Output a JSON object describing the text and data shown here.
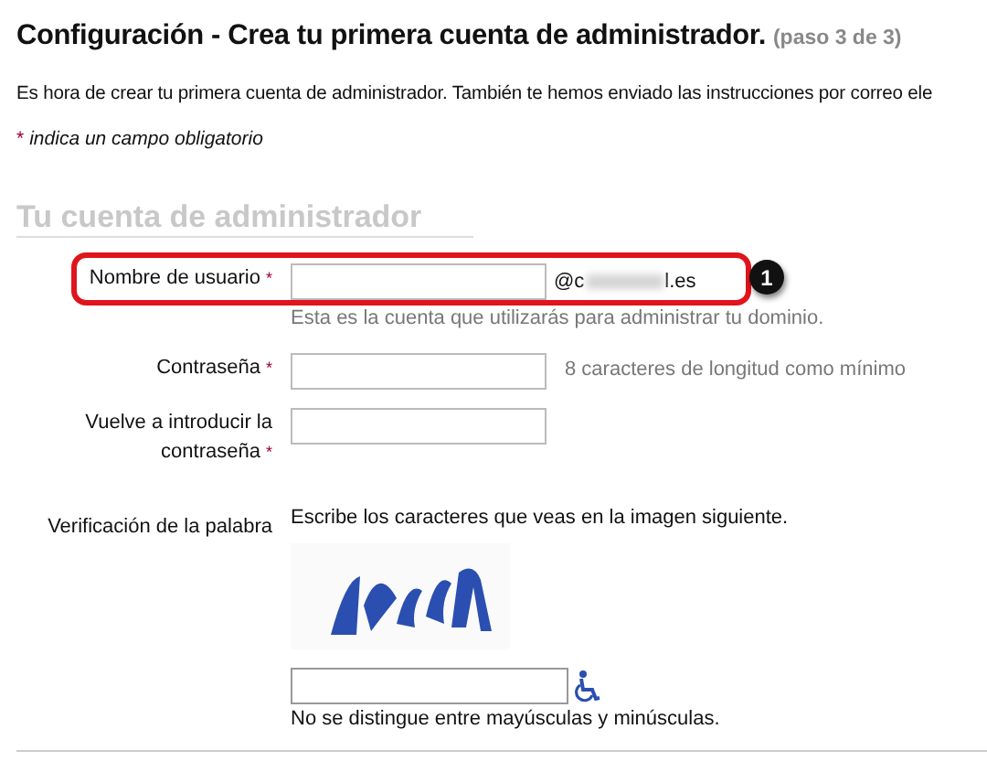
{
  "title": "Configuración - Crea tu primera cuenta de administrador.",
  "step": "(paso 3 de 3)",
  "intro": "Es hora de crear tu primera cuenta de administrador. También te hemos enviado las instrucciones por correo ele",
  "required_mark": "*",
  "required_note": "indica un campo obligatorio",
  "section_title": "Tu cuenta de administrador",
  "fields": [
    {
      "label": "Nombre de usuario",
      "required": true,
      "domain_start": "@c",
      "domain_end": "l.es",
      "hint": "Esta es la cuenta que utilizarás para administrar tu dominio.",
      "highlighted": true,
      "callout": "1"
    },
    {
      "label": "Contraseña",
      "required": true,
      "side_hint": "8 caracteres de longitud como mínimo",
      "highlighted": false
    },
    {
      "label": "Vuelve a introducir la contraseña",
      "required": true,
      "highlighted": false
    }
  ],
  "captcha": {
    "label": "Verificación de la palabra",
    "instructions": "Escribe los caracteres que veas en la imagen siguiente.",
    "note": "No se distingue entre mayúsculas y minúsculas."
  }
}
